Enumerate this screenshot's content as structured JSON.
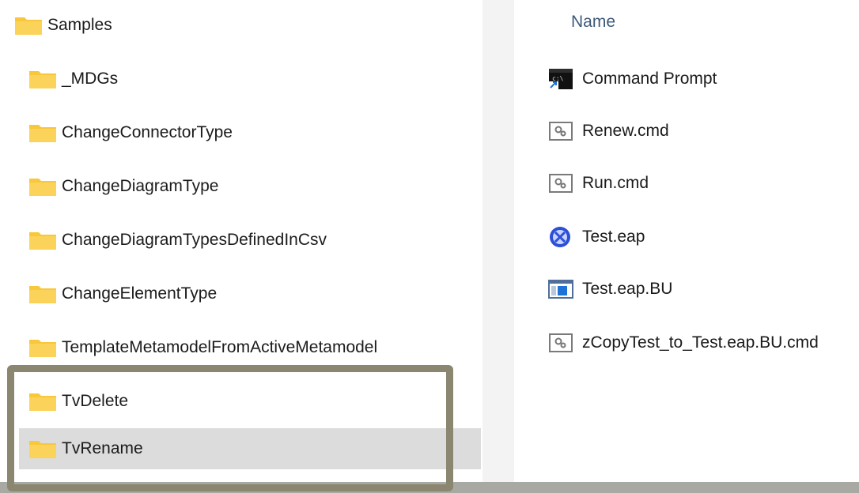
{
  "tree": {
    "root": "Samples",
    "children": [
      "_MDGs",
      "ChangeConnectorType",
      "ChangeDiagramType",
      "ChangeDiagramTypesDefinedInCsv",
      "ChangeElementType",
      "TemplateMetamodelFromActiveMetamodel",
      "TvDelete",
      "TvRename"
    ],
    "selected": "TvRename"
  },
  "files": {
    "column_header": "Name",
    "items": [
      {
        "name": "Command Prompt",
        "icon": "command-prompt-icon"
      },
      {
        "name": "Renew.cmd",
        "icon": "cmd-script-icon"
      },
      {
        "name": "Run.cmd",
        "icon": "cmd-script-icon"
      },
      {
        "name": "Test.eap",
        "icon": "eap-file-icon"
      },
      {
        "name": "Test.eap.BU",
        "icon": "bu-file-icon"
      },
      {
        "name": "zCopyTest_to_Test.eap.BU.cmd",
        "icon": "cmd-script-icon"
      }
    ]
  },
  "colors": {
    "folder": "#f8c73c",
    "selection": "#dcdcdc",
    "highlight_border": "#8b8670",
    "header_text": "#3d5a7a"
  }
}
